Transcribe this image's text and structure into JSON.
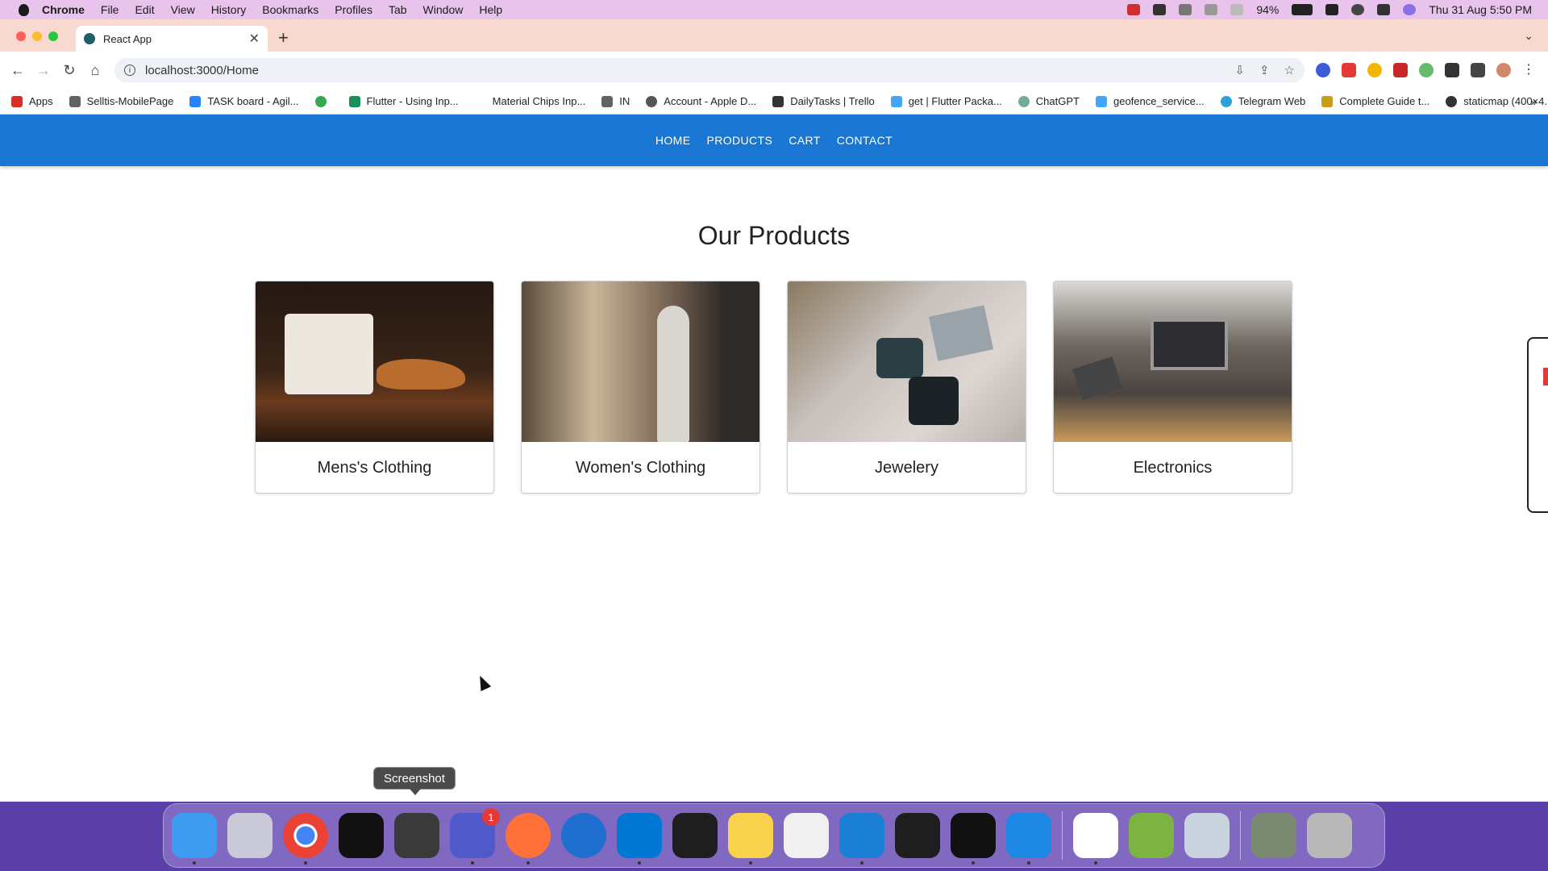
{
  "menubar": {
    "app_name": "Chrome",
    "items": [
      "File",
      "Edit",
      "View",
      "History",
      "Bookmarks",
      "Profiles",
      "Tab",
      "Window",
      "Help"
    ],
    "battery": "94%",
    "datetime": "Thu 31 Aug  5:50 PM"
  },
  "browser": {
    "tab_title": "React App",
    "url": "localhost:3000/Home",
    "bookmarks": [
      {
        "label": "Apps",
        "icon": "apps-grid-icon",
        "color": "#d93025"
      },
      {
        "label": "Selltis-MobilePage",
        "icon": "folder-icon",
        "color": "#5f6368"
      },
      {
        "label": "TASK board - Agil...",
        "icon": "jira-icon",
        "color": "#2684ff"
      },
      {
        "label": "",
        "icon": "green-circle-icon",
        "color": "#34a853"
      },
      {
        "label": "Flutter - Using Inp...",
        "icon": "w-icon",
        "color": "#1b8f5a"
      },
      {
        "label": "Material Chips Inp...",
        "icon": "blank-icon",
        "color": "#ffffff"
      },
      {
        "label": "IN",
        "icon": "folder-icon",
        "color": "#5f6368"
      },
      {
        "label": "Account - Apple D...",
        "icon": "apple-icon",
        "color": "#555555"
      },
      {
        "label": "DailyTasks | Trello",
        "icon": "trello-icon",
        "color": "#333333"
      },
      {
        "label": "get | Flutter Packa...",
        "icon": "flutter-icon",
        "color": "#42a5f5"
      },
      {
        "label": "ChatGPT",
        "icon": "chatgpt-icon",
        "color": "#74aa9c"
      },
      {
        "label": "geofence_service...",
        "icon": "flutter-icon",
        "color": "#42a5f5"
      },
      {
        "label": "Telegram Web",
        "icon": "telegram-icon",
        "color": "#2aa1da"
      },
      {
        "label": "Complete Guide t...",
        "icon": "v-icon",
        "color": "#c69c1a"
      },
      {
        "label": "staticmap (400×4...",
        "icon": "globe-icon",
        "color": "#333333"
      }
    ]
  },
  "site": {
    "nav": [
      "HOME",
      "PRODUCTS",
      "CART",
      "CONTACT"
    ],
    "title": "Our Products",
    "categories": [
      {
        "label": "Mens's Clothing",
        "image": "mens-clothing-image",
        "colors": [
          "#3a2418",
          "#c07a3a",
          "#e8e4dc"
        ]
      },
      {
        "label": "Women's Clothing",
        "image": "womens-clothing-image",
        "colors": [
          "#6b5844",
          "#c9b79a",
          "#2e2a27"
        ]
      },
      {
        "label": "Jewelery",
        "image": "jewelery-image",
        "colors": [
          "#c8c0bc",
          "#2a3e44",
          "#8a7a60"
        ]
      },
      {
        "label": "Electronics",
        "image": "electronics-image",
        "colors": [
          "#4a4440",
          "#c99a5a",
          "#dcdad6"
        ]
      }
    ]
  },
  "dock": {
    "tooltip": "Screenshot",
    "apps": [
      {
        "name": "finder-icon",
        "color": "#3d9bf0"
      },
      {
        "name": "launchpad-icon",
        "color": "#c9c9d8"
      },
      {
        "name": "chrome-icon",
        "color": "#ea4335"
      },
      {
        "name": "intellij-icon",
        "color": "#111111"
      },
      {
        "name": "screenshot-icon",
        "color": "#3a3a3a"
      },
      {
        "name": "teams-icon",
        "color": "#5059c9",
        "badge": "1"
      },
      {
        "name": "firefox-icon",
        "color": "#ff7139"
      },
      {
        "name": "xcode-instruments-icon",
        "color": "#1f6fd0"
      },
      {
        "name": "vscode-icon",
        "color": "#0078d4"
      },
      {
        "name": "terminal-exec-icon",
        "color": "#1e1e1e"
      },
      {
        "name": "notes-icon",
        "color": "#f7d24a"
      },
      {
        "name": "textedit-icon",
        "color": "#f0f0f0"
      },
      {
        "name": "xcode-icon",
        "color": "#1c7fd6"
      },
      {
        "name": "terminal-exec-icon-2",
        "color": "#1e1e1e"
      },
      {
        "name": "terminal-icon",
        "color": "#111111"
      },
      {
        "name": "app-store-dev-icon",
        "color": "#1e88e5"
      },
      {
        "name": "mongodb-icon",
        "color": "#ffffff"
      },
      {
        "name": "android-studio-icon",
        "color": "#7cb342"
      },
      {
        "name": "preview-icon",
        "color": "#c9d3de"
      },
      {
        "name": "photo-stack-icon",
        "color": "#7a8a70"
      },
      {
        "name": "trash-icon",
        "color": "#b8b8b8"
      }
    ]
  }
}
